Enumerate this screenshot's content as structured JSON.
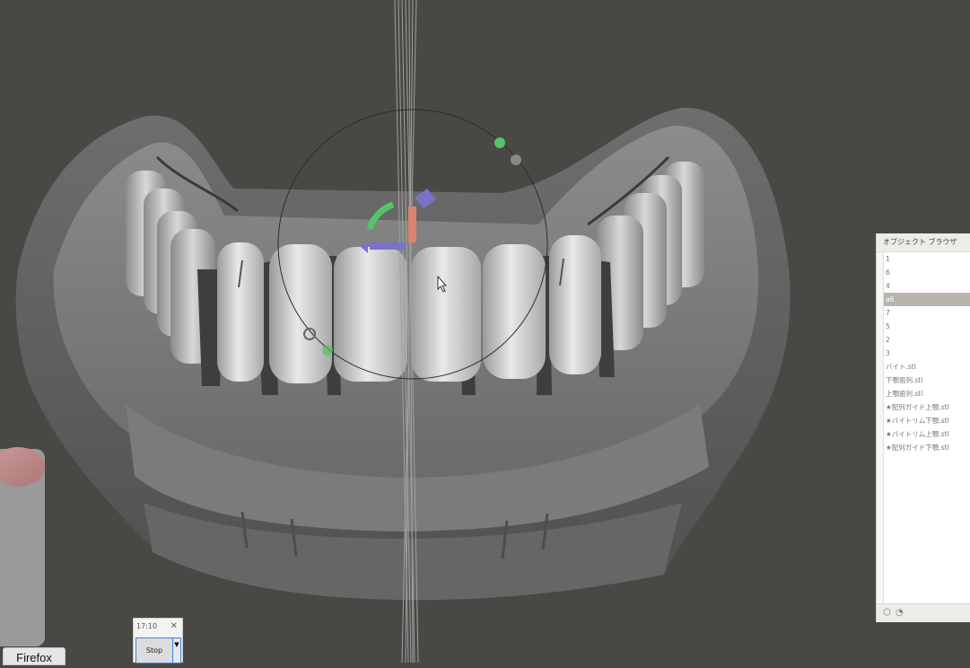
{
  "viewport": {
    "background": "#4a4845",
    "model": "dental-arch-scan",
    "cursor": "arrow-cursor"
  },
  "gizmo": {
    "colors": {
      "rotate_ring": "#55c46a",
      "x_arrow": "#7a72c8",
      "y_arrow": "#d9826e",
      "circle": "#2e2c2a"
    }
  },
  "object_browser": {
    "title": "オブジェクト ブラウザ",
    "items": [
      {
        "label": "1",
        "selected": false
      },
      {
        "label": "6",
        "selected": false
      },
      {
        "label": "4",
        "selected": false
      },
      {
        "label": "a6",
        "selected": true
      },
      {
        "label": "7",
        "selected": false
      },
      {
        "label": "5",
        "selected": false
      },
      {
        "label": "2",
        "selected": false
      },
      {
        "label": "3",
        "selected": false
      },
      {
        "label": "バイト.stl",
        "selected": false
      },
      {
        "label": "下顎歯列.stl",
        "selected": false
      },
      {
        "label": "上顎歯列.stl",
        "selected": false
      },
      {
        "label": "★配列ガイド上顎.stl",
        "selected": false
      },
      {
        "label": "★バイトリム下顎.stl",
        "selected": false
      },
      {
        "label": "★バイトリム上顎.stl",
        "selected": false
      },
      {
        "label": "★配列ガイド下顎.stl",
        "selected": false
      }
    ],
    "footer_icons": [
      "cube-icon",
      "clock-icon"
    ]
  },
  "recorder": {
    "time": "17:10",
    "close_glyph": "✕",
    "stop_label": "Stop",
    "dropdown_glyph": "▼"
  },
  "taskbar": {
    "firefox_label": "Firefox"
  }
}
